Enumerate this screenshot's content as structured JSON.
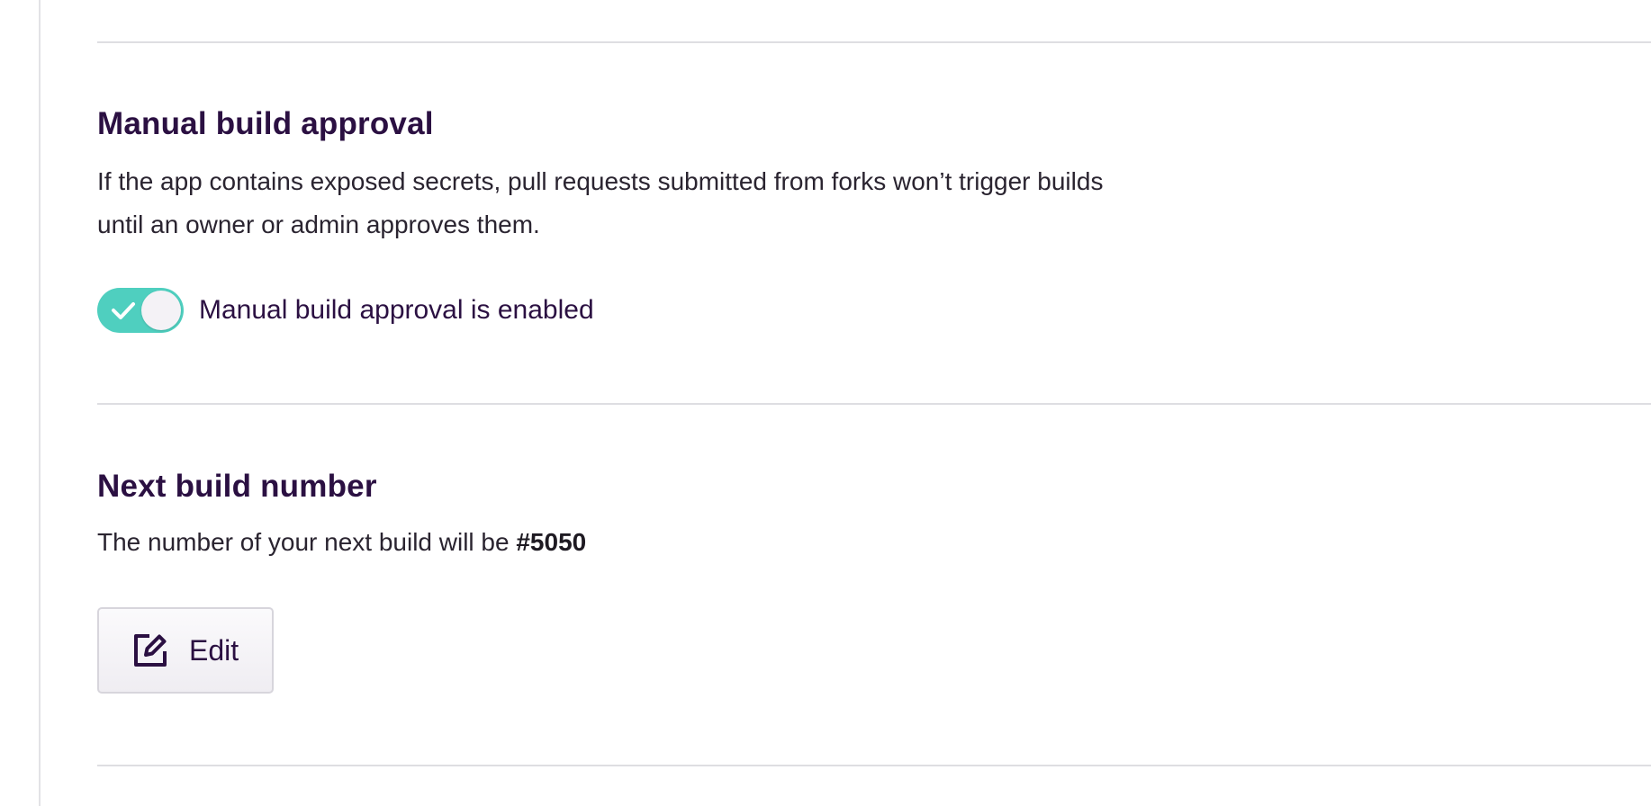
{
  "manual_approval": {
    "title": "Manual build approval",
    "description_line1": "If the app contains exposed secrets, pull requests submitted from forks won’t trigger builds",
    "description_line2": "until an owner or admin approves them.",
    "toggle": {
      "enabled": true,
      "label": "Manual build approval is enabled"
    }
  },
  "next_build": {
    "title": "Next build number",
    "description_prefix": "The number of your next build will be ",
    "build_number": "#5050",
    "edit_label": "Edit"
  },
  "colors": {
    "heading": "#2b1042",
    "toggle_on": "#4fcfbf",
    "divider": "#dedee2"
  },
  "icons": {
    "toggle": "check-icon",
    "edit": "pencil-square-icon"
  }
}
